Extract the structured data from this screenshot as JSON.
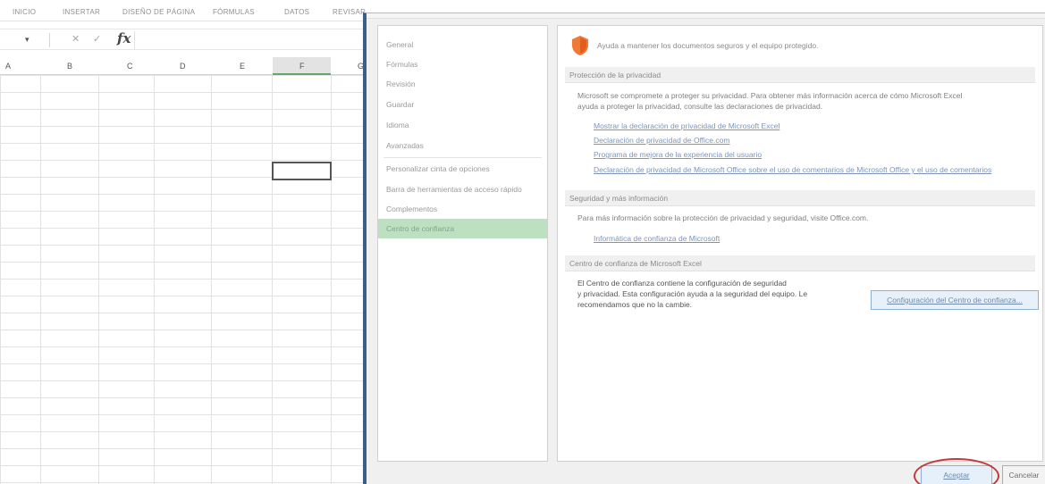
{
  "excel": {
    "ribbon_tabs": [
      "INICIO",
      "INSERTAR",
      "DISEÑO DE PÁGINA",
      "FÓRMULAS",
      "DATOS",
      "REVISAR"
    ],
    "name_box_arrow": "▾",
    "cancel_symbol": "✕",
    "enter_symbol": "✓",
    "fx_symbol": "fx",
    "columns": [
      "A",
      "B",
      "C",
      "D",
      "E",
      "F",
      "G"
    ]
  },
  "dialog": {
    "nav": {
      "items": [
        {
          "label": "General"
        },
        {
          "label": "Fórmulas"
        },
        {
          "label": "Revisión"
        },
        {
          "label": "Guardar"
        },
        {
          "label": "Idioma"
        },
        {
          "label": "Avanzadas"
        },
        {
          "label": "Personalizar cinta de opciones"
        },
        {
          "label": "Barra de herramientas de acceso rápido"
        },
        {
          "label": "Complementos"
        },
        {
          "label": "Centro de confianza"
        }
      ],
      "active_index": 9
    },
    "intro": "Ayuda a mantener los documentos seguros y el equipo protegido.",
    "privacy": {
      "heading": "Protección de la privacidad",
      "line1": "Microsoft se compromete a proteger su privacidad. Para obtener más información acerca de cómo Microsoft Excel",
      "line2": "ayuda a proteger la privacidad, consulte las declaraciones de privacidad.",
      "links": [
        "Mostrar la declaración de privacidad de Microsoft Excel",
        "Declaración de privacidad de Office.com",
        "Programa de mejora de la experiencia del usuario",
        "Declaración de privacidad de Microsoft Office sobre el uso de comentarios de Microsoft Office y el uso de comentarios"
      ]
    },
    "security": {
      "heading": "Seguridad y más información",
      "text": "Para más información sobre la protección de privacidad y seguridad, visite Office.com.",
      "link": "Informática de confianza de Microsoft"
    },
    "trust_center": {
      "heading": "Centro de confianza de Microsoft Excel",
      "line1": "El Centro de confianza contiene la configuración de seguridad",
      "line2": "y privacidad. Esta configuración ayuda a la seguridad del equipo. Le",
      "line3": "recomendamos que no la cambie.",
      "button": "Configuración del Centro de confianza..."
    },
    "buttons": {
      "ok": "Aceptar",
      "cancel": "Cancelar"
    }
  }
}
